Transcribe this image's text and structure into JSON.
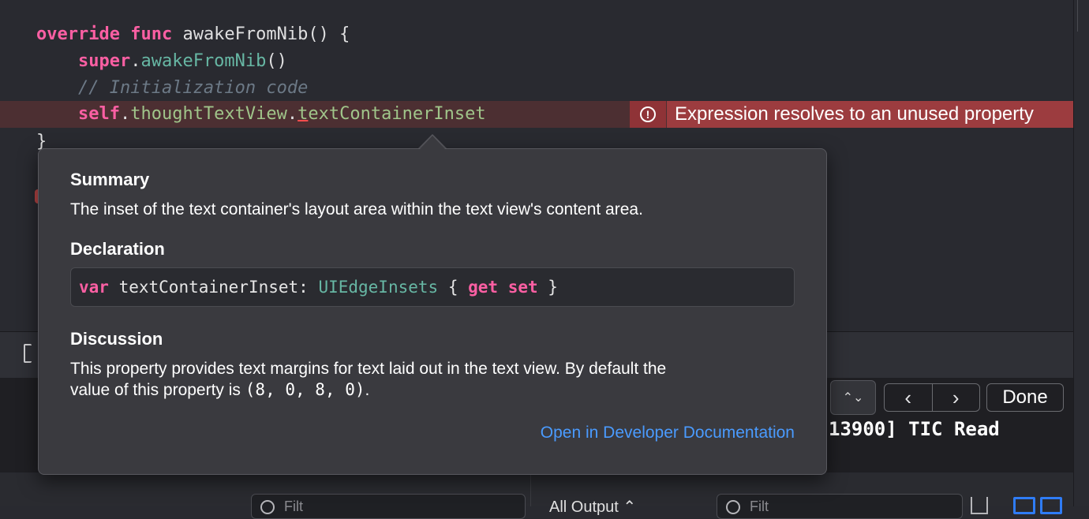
{
  "editor": {
    "lines": [
      {
        "tokens": [
          {
            "text": "override",
            "cls": "kw"
          },
          {
            "text": " "
          },
          {
            "text": "func",
            "cls": "kw"
          },
          {
            "text": " awakeFromNib() {"
          }
        ]
      },
      {
        "tokens": [
          {
            "text": "    "
          },
          {
            "text": "super",
            "cls": "kw"
          },
          {
            "text": "."
          },
          {
            "text": "awakeFromNib",
            "cls": "fn"
          },
          {
            "text": "()"
          }
        ]
      },
      {
        "tokens": [
          {
            "text": "    "
          },
          {
            "text": "// Initialization code",
            "cls": "cmt"
          }
        ]
      },
      {
        "tokens": [
          {
            "text": "    "
          },
          {
            "text": "self",
            "cls": "kw"
          },
          {
            "text": "."
          },
          {
            "text": "thoughtTextView",
            "cls": "prop"
          },
          {
            "text": "."
          },
          {
            "text": "t",
            "cls": "prop err-underline"
          },
          {
            "text": "extContainerInset",
            "cls": "prop"
          }
        ]
      },
      {
        "tokens": [
          {
            "text": "}"
          }
        ]
      }
    ],
    "error_message": "Expression resolves to an unused property",
    "error_icon": "!"
  },
  "popover": {
    "summary_heading": "Summary",
    "summary_text": "The inset of the text container's layout area within the text view's content area.",
    "declaration_heading": "Declaration",
    "declaration_tokens": [
      {
        "text": "var",
        "cls": "kw"
      },
      {
        "text": " textContainerInset: "
      },
      {
        "text": "UIEdgeInsets",
        "cls": "fn"
      },
      {
        "text": " { "
      },
      {
        "text": "get",
        "cls": "kw"
      },
      {
        "text": " "
      },
      {
        "text": "set",
        "cls": "kw"
      },
      {
        "text": " }"
      }
    ],
    "discussion_heading": "Discussion",
    "discussion_text_1": "This property provides text margins for text laid out in the text view. By default the",
    "discussion_text_2a": "value of this property is ",
    "discussion_text_code": "(8, 0, 8, 0)",
    "discussion_text_2b": ".",
    "doc_link": "Open in Developer Documentation"
  },
  "debug": {
    "console_text": "13900] TIC Read",
    "nav_prev": "‹",
    "nav_next": "›",
    "done_label": "Done",
    "stepper_glyph": "⌃⌄",
    "filter_placeholder": "Filt",
    "output_label": "All Output ⌃"
  }
}
